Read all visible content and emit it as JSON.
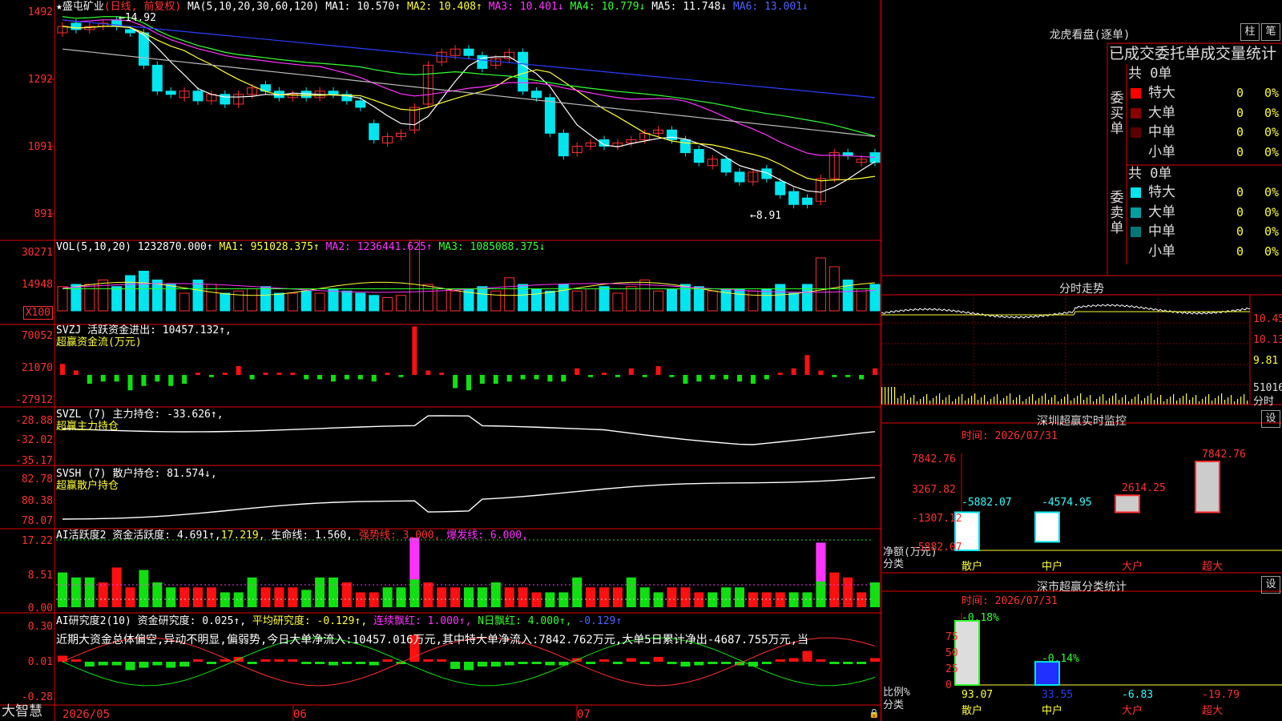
{
  "stock": {
    "star": "★",
    "name": "盛屯矿业",
    "mode": "(日线, 前复权)"
  },
  "ma_header": {
    "label": "MA(5,10,20,30,60,120)",
    "ma1": "MA1: 10.570↑",
    "ma2": "MA2: 10.408↑",
    "ma3": "MA3: 10.401↓",
    "ma4": "MA4: 10.779↓",
    "ma5": "MA5: 11.748↓",
    "ma6": "MA6: 13.001↓"
  },
  "price_axis": [
    "1492",
    "1292",
    "1091",
    "891"
  ],
  "price_marks": {
    "high": "14.92",
    "low": "8.91"
  },
  "vol_header": {
    "label": "VOL(5,10,20)",
    "value": "1232870.000↑",
    "ma1": "MA1: 951028.375↑",
    "ma2": "MA2: 1236441.625↑",
    "ma3": "MA3: 1085088.375↓"
  },
  "vol_axis": [
    "30271",
    "14948",
    "X100"
  ],
  "svzj": {
    "title": "SVZJ  活跃资金进出: 10457.132↑,",
    "sub": "超赢资金流(万元)",
    "axis": [
      "70052",
      "21070",
      "-27912"
    ]
  },
  "svzl": {
    "title": "SVZL (7) 主力持仓: -33.626↑,",
    "sub": "超赢主力持仓",
    "axis": [
      "-28.88",
      "-32.02",
      "-35.17"
    ]
  },
  "svsh": {
    "title": "SVSH (7) 散户持仓: 81.574↓,",
    "sub": "超赢散户持仓",
    "axis": [
      "82.78",
      "80.38",
      "78.07"
    ]
  },
  "ai_active": {
    "t1": "AI活跃度2 资金活跃度: 4.691↑,",
    "t2": "17.219,",
    "t3": "生命线: 1.560,",
    "t4": "强势线: 3.000,",
    "t5": "爆发线: 6.000,",
    "axis": [
      "17.22",
      "8.51",
      "0.00"
    ]
  },
  "ai_research": {
    "t1": "AI研究度2(10) 资金研究度: 0.025↑,",
    "t2": "平均研究度: -0.129↑,",
    "t3": "连续飘红: 1.000↑,",
    "t4": "N日飘红: 4.000↑,",
    "t5": "-0.129↑",
    "axis": [
      "0.30",
      "0.01",
      "-0.28"
    ],
    "text": "近期大资金总体偏空,异动不明显,偏弱势,今日大单净流入:10457.016万元,其中特大单净流入:7842.762万元,大单5日累计净出-4687.755万元,当"
  },
  "bottom": {
    "brand": "大智慧",
    "dates": [
      "2026/05",
      "06",
      "07"
    ]
  },
  "right": {
    "dragon_title": "龙虎看盘(逐单)",
    "btn_bar": "柱",
    "btn_pen": "笔",
    "stat_title": "已成交委托单成交量统计",
    "buy_cap": "委买单",
    "sell_cap": "委卖单",
    "buy_total": "共 0单",
    "sell_total": "共 0单",
    "buy_rows": [
      {
        "name": "特大",
        "cnt": "0",
        "pct": "0%",
        "color": "#ff0000"
      },
      {
        "name": "大单",
        "cnt": "0",
        "pct": "0%",
        "color": "#8b0000"
      },
      {
        "name": "中单",
        "cnt": "0",
        "pct": "0%",
        "color": "#5a0000"
      },
      {
        "name": "小单",
        "cnt": "0",
        "pct": "0%",
        "color": ""
      }
    ],
    "sell_rows": [
      {
        "name": "特大",
        "cnt": "0",
        "pct": "0%",
        "color": "#00e5ee"
      },
      {
        "name": "大单",
        "cnt": "0",
        "pct": "0%",
        "color": "#00a0a0"
      },
      {
        "name": "中单",
        "cnt": "0",
        "pct": "0%",
        "color": "#007878"
      },
      {
        "name": "小单",
        "cnt": "0",
        "pct": "0%",
        "color": ""
      }
    ],
    "intraday_title": "分时走势",
    "intraday_axis": [
      "10.45",
      "10.13",
      "9.81",
      "51016",
      "分时"
    ],
    "sz_monitor_title": "深圳超赢实时监控",
    "set": "设",
    "sz_time": "时间: 2026/07/31",
    "net_axis": [
      "7842.76",
      "3267.82",
      "-1307.12",
      "-5882.07"
    ],
    "net_caps": [
      "净额(万元)",
      "分类"
    ],
    "net_cats": [
      "散户",
      "中户",
      "大户",
      "超大"
    ],
    "net_values": [
      "-5882.07",
      "-4574.95",
      "2614.25",
      "7842.76"
    ],
    "cls_title": "深市超赢分类统计",
    "cls_time": "时间: 2026/07/31",
    "cls_axis": [
      "75",
      "50",
      "25",
      "0"
    ],
    "cls_caps": [
      "比例%",
      "分类"
    ],
    "cls_top": [
      "-0.18%",
      "-0.14%"
    ],
    "cls_vals": [
      "93.07",
      "33.55",
      "-6.83",
      "-19.79"
    ],
    "cls_cats": [
      "散户",
      "中户",
      "大户",
      "超大"
    ]
  },
  "chart_data": {
    "type": "candlestick",
    "x_dates": [
      "2026/05",
      "06",
      "07"
    ],
    "price_ylim": [
      8.91,
      14.92
    ],
    "net_flow_by_class": {
      "categories": [
        "散户",
        "中户",
        "大户",
        "超大"
      ],
      "values": [
        -5882.07,
        -4574.95,
        2614.25,
        7842.76
      ]
    },
    "class_ratio": {
      "categories": [
        "散户",
        "中户",
        "大户",
        "超大"
      ],
      "values": [
        93.07,
        33.55,
        -6.83,
        -19.79
      ]
    }
  }
}
